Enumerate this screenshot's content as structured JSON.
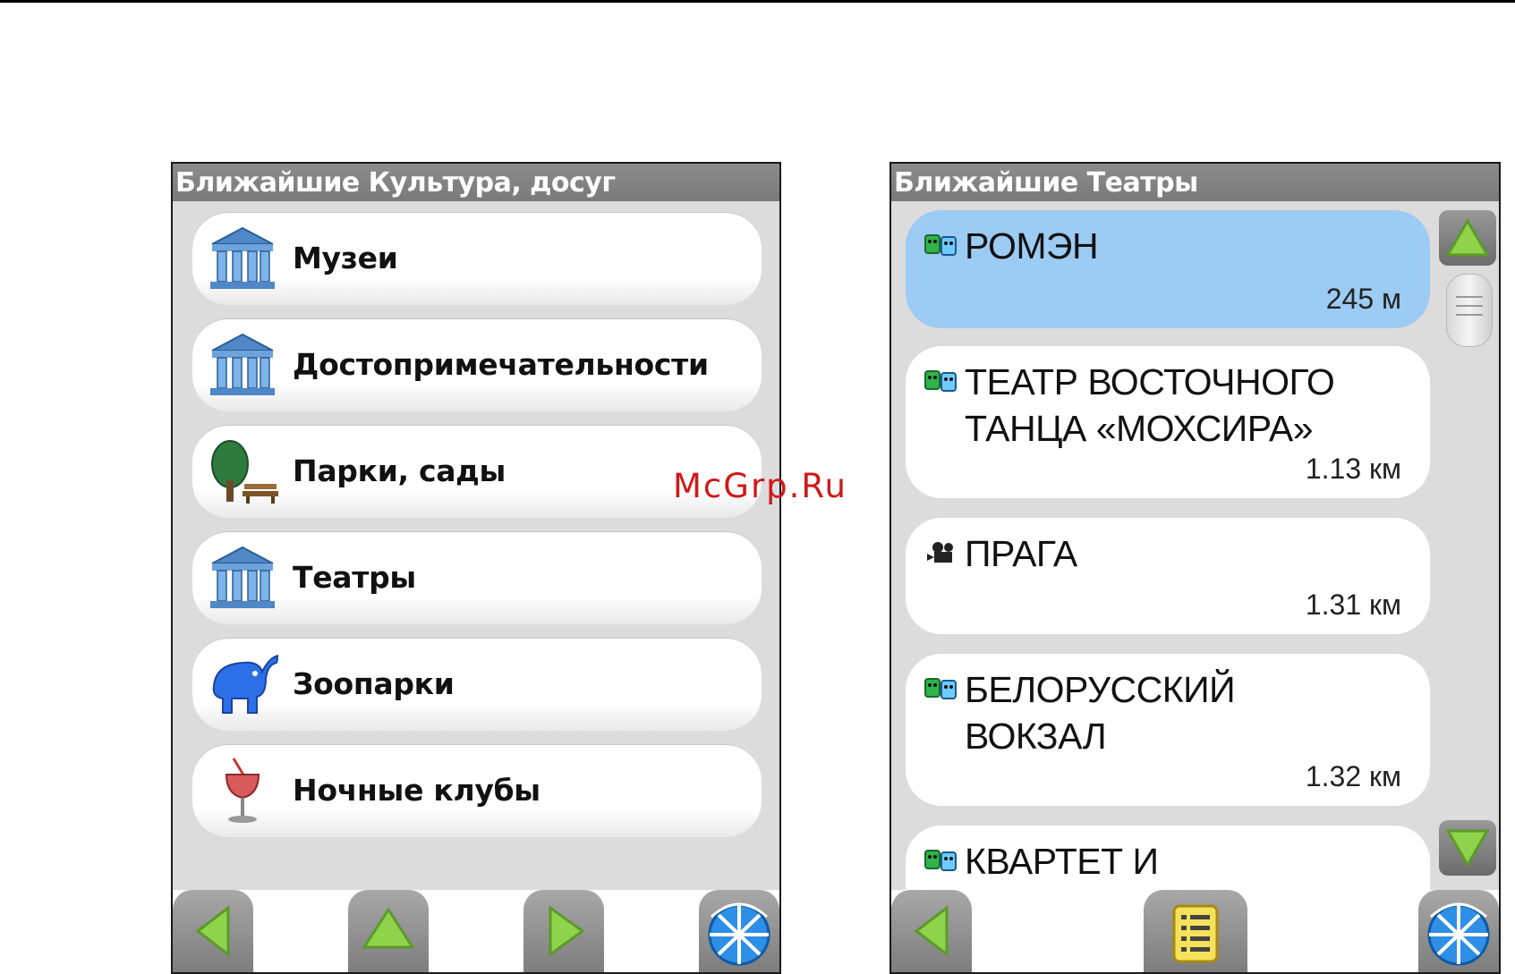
{
  "left_screen": {
    "title": "Ближайшие Культура, досуг",
    "items": [
      {
        "label": "Музеи",
        "icon": "museum-icon"
      },
      {
        "label": "Достопримечательности",
        "icon": "museum-icon"
      },
      {
        "label": "Парки, сады",
        "icon": "park-tree-icon"
      },
      {
        "label": "Театры",
        "icon": "museum-icon"
      },
      {
        "label": "Зоопарки",
        "icon": "elephant-icon"
      },
      {
        "label": "Ночные клубы",
        "icon": "cocktail-glass-icon"
      }
    ],
    "bottom_bar": [
      "back-arrow-icon",
      "up-arrow-icon",
      "forward-arrow-icon",
      "globe-icon"
    ]
  },
  "right_screen": {
    "title": "Ближайшие Театры",
    "items": [
      {
        "name": "РОМЭН",
        "distance": "245 м",
        "icon": "theatre-masks-icon",
        "selected": true
      },
      {
        "name": "ТЕАТР ВОСТОЧНОГО ТАНЦА «МОХСИРА»",
        "distance": "1.13 км",
        "icon": "theatre-masks-icon",
        "selected": false
      },
      {
        "name": "ПРАГА",
        "distance": "1.31 км",
        "icon": "cinema-camera-icon",
        "selected": false
      },
      {
        "name": "БЕЛОРУССКИЙ ВОКЗАЛ",
        "distance": "1.32 км",
        "icon": "theatre-masks-icon",
        "selected": false
      },
      {
        "name": "КВАРТЕТ И",
        "distance": "",
        "icon": "theatre-masks-icon",
        "selected": false
      }
    ],
    "bottom_bar": [
      "back-arrow-icon",
      "list-icon",
      "globe-icon"
    ],
    "scrollbar": [
      "scroll-up-icon",
      "scroll-thumb",
      "scroll-down-icon"
    ]
  },
  "colors": {
    "title_bar": "#808080",
    "screen_bg": "#dcdcdc",
    "selected_item": "#9ccbf4",
    "arrow_green": "#8fd34a",
    "watermark": "#d01818"
  },
  "watermark": "McGrp.Ru"
}
